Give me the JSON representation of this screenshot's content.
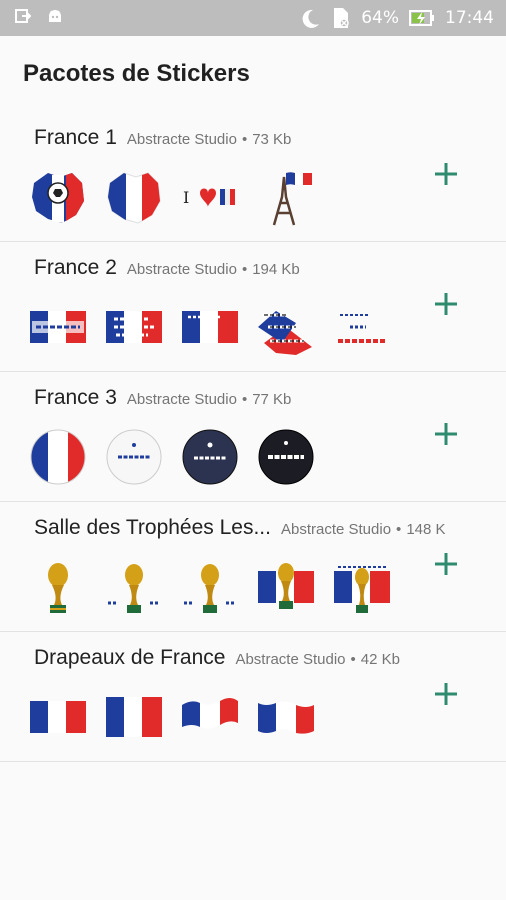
{
  "status_bar": {
    "battery": "64%",
    "time": "17:44",
    "icons": [
      "usb-debug-icon",
      "android-icon",
      "moon-icon",
      "sim-icon",
      "battery-charging-icon"
    ]
  },
  "title": "Pacotes de Stickers",
  "packs": [
    {
      "name": "France 1",
      "publisher": "Abstracte Studio",
      "separator": "•",
      "size": "73 Kb",
      "stickers": [
        "france-map-soccer-ball",
        "france-map-flag",
        "i-love-france",
        "eiffel-tower-flag"
      ]
    },
    {
      "name": "France 2",
      "publisher": "Abstracte Studio",
      "separator": "•",
      "size": "194 Kb",
      "stickers": [
        "france-flag-text",
        "allez-flag",
        "allez-small-flag",
        "allez-les-bleus-text",
        "allez-la-france-text"
      ]
    },
    {
      "name": "France 3",
      "publisher": "Abstracte Studio",
      "separator": "•",
      "size": "77 Kb",
      "stickers": [
        "flag-ball",
        "france-badge-white",
        "france-badge-dark",
        "france-badge-black"
      ]
    },
    {
      "name": "Salle des Trophées Les...",
      "publisher": "Abstracte Studio",
      "separator": "•",
      "size": "148 K",
      "stickers": [
        "world-cup-trophy",
        "trophy-1998",
        "trophy-2018",
        "trophy-flag",
        "trophy-flag-2"
      ]
    },
    {
      "name": "Drapeaux de France",
      "publisher": "Abstracte Studio",
      "separator": "•",
      "size": "42 Kb",
      "stickers": [
        "flag-flat",
        "flag-flat-2",
        "flag-waving",
        "flag-waving-2"
      ]
    }
  ],
  "add_label": "+",
  "colors": {
    "accent": "#2e8b6e",
    "blue": "#1f3d9c",
    "red": "#e12b2b",
    "white": "#ffffff"
  }
}
